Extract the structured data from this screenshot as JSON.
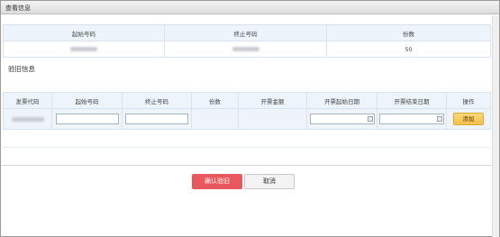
{
  "dialog": {
    "title": "查看信息"
  },
  "summary": {
    "headers": [
      "起始号码",
      "终止号码",
      "份数"
    ],
    "values": [
      "",
      "",
      "50"
    ]
  },
  "section": {
    "title": "验旧信息"
  },
  "grid": {
    "headers": [
      "发票代码",
      "起始号码",
      "终止号码",
      "份数",
      "开票金额",
      "开票起始日期",
      "开票结束日期",
      "操作"
    ],
    "row": {
      "start_placeholder": "",
      "end_placeholder": "",
      "date_start_placeholder": "",
      "date_end_placeholder": "",
      "add_label": "添加"
    }
  },
  "footer": {
    "confirm_label": "确认验旧",
    "cancel_label": "取消"
  },
  "colors": {
    "confirm": "#e9585c",
    "add": "#f3bf49",
    "header_bg": "#edf4fb"
  },
  "icons": [
    "calendar-icon"
  ]
}
